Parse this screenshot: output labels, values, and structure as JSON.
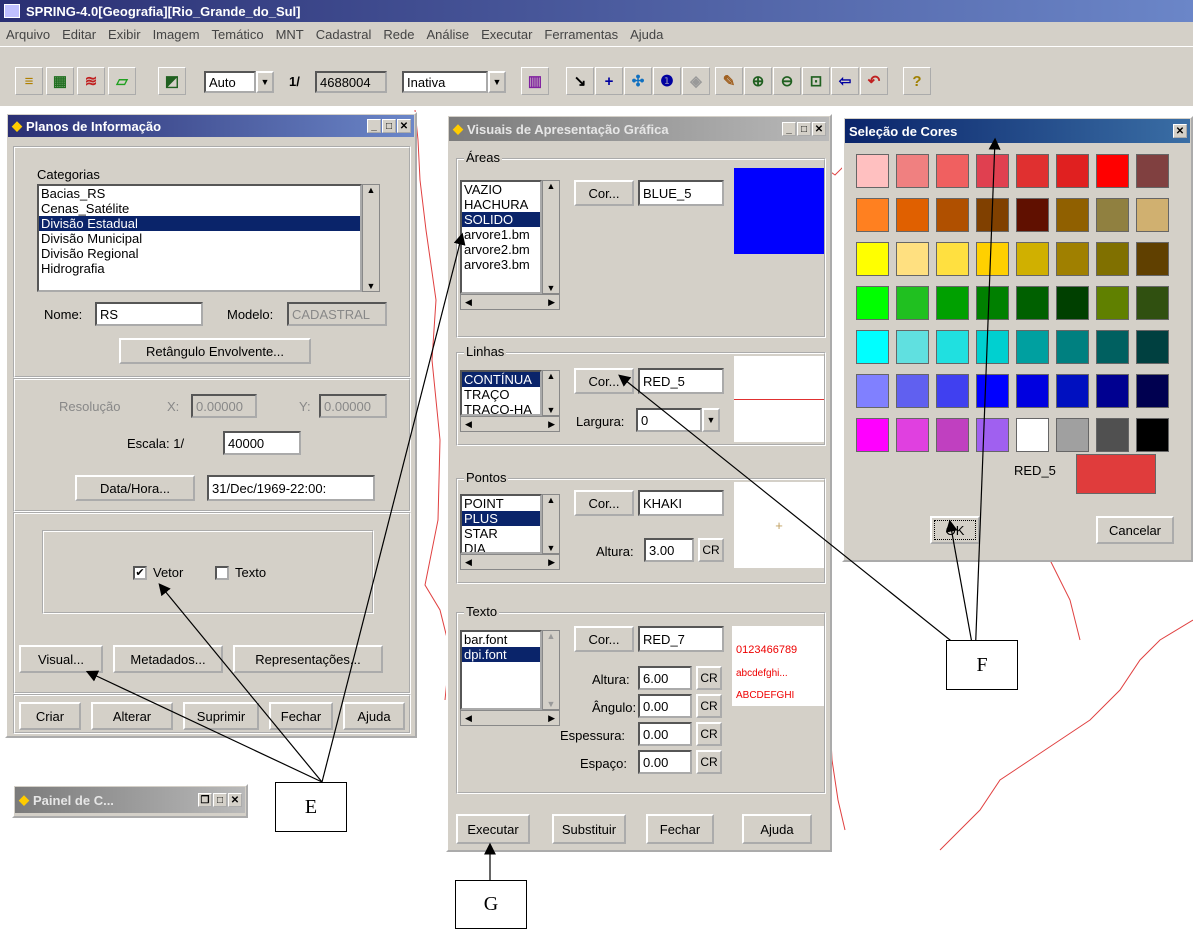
{
  "app": {
    "title": "SPRING-4.0[Geografia][Rio_Grande_do_Sul]"
  },
  "menu": [
    "Arquivo",
    "Editar",
    "Exibir",
    "Imagem",
    "Temático",
    "MNT",
    "Cadastral",
    "Rede",
    "Análise",
    "Executar",
    "Ferramentas",
    "Ajuda"
  ],
  "toolbar": {
    "mode_value": "Auto",
    "scale_prefix": "1/",
    "scale_value": "4688004",
    "state_value": "Inativa"
  },
  "planos": {
    "title": "Planos de Informação",
    "categories_label": "Categorias",
    "categories": [
      "Bacias_RS",
      "Cenas_Satélite",
      "Divisão Estadual",
      "Divisão Municipal",
      "Divisão Regional",
      "Hidrografia"
    ],
    "selected_category": "Divisão Estadual",
    "nome_label": "Nome:",
    "nome_value": "RS",
    "modelo_label": "Modelo:",
    "modelo_value": "CADASTRAL",
    "retangulo": "Retângulo Envolvente...",
    "resolucao": "Resolução",
    "x_label": "X:",
    "x_value": "0.00000",
    "y_label": "Y:",
    "y_value": "0.00000",
    "escala_label": "Escala: 1/",
    "escala_value": "40000",
    "datahora_btn": "Data/Hora...",
    "datahora_value": "31/Dec/1969-22:00:",
    "vetor": "Vetor",
    "texto": "Texto",
    "vetor_checked": "✔",
    "visual": "Visual...",
    "metadados": "Metadados...",
    "representacoes": "Representações...",
    "criar": "Criar",
    "alterar": "Alterar",
    "suprimir": "Suprimir",
    "fechar": "Fechar",
    "ajuda": "Ajuda"
  },
  "painel": {
    "title": "Painel de C..."
  },
  "visuais": {
    "title": "Visuais de Apresentação Gráfica",
    "areas": {
      "label": "Áreas",
      "items": [
        "VAZIO",
        "HACHURA",
        "SOLIDO",
        "arvore1.bm",
        "arvore2.bm",
        "arvore3.bm"
      ],
      "selected": "SOLIDO",
      "cor_btn": "Cor...",
      "cor_value": "BLUE_5",
      "color": "#0000ff"
    },
    "linhas": {
      "label": "Linhas",
      "items": [
        "CONTÍNUA",
        "TRAÇO",
        "TRAÇO-HA"
      ],
      "selected": "CONTÍNUA",
      "cor_btn": "Cor...",
      "cor_value": "RED_5",
      "largura_label": "Largura:",
      "largura_value": "0",
      "color": "#e03030"
    },
    "pontos": {
      "label": "Pontos",
      "items": [
        "POINT",
        "PLUS",
        "STAR",
        "DIA"
      ],
      "selected": "PLUS",
      "cor_btn": "Cor...",
      "cor_value": "KHAKI",
      "altura_label": "Altura:",
      "altura_value": "3.00",
      "cr": "CR",
      "symbol": "+"
    },
    "texto": {
      "label": "Texto",
      "items": [
        "bar.font",
        "dpi.font"
      ],
      "selected": "dpi.font",
      "cor_btn": "Cor...",
      "cor_value": "RED_7",
      "altura_label": "Altura:",
      "altura_value": "6.00",
      "angulo_label": "Ângulo:",
      "angulo_value": "0.00",
      "espessura_label": "Espessura:",
      "espessura_value": "0.00",
      "espaco_label": "Espaço:",
      "espaco_value": "0.00",
      "cr": "CR",
      "preview1": "0123466789",
      "preview2": "abcdefghi...",
      "preview3": "ABCDEFGHI"
    },
    "executar": "Executar",
    "substituir": "Substituir",
    "fechar": "Fechar",
    "ajuda": "Ajuda"
  },
  "cores": {
    "title": "Seleção de Cores",
    "selected_name": "RED_5",
    "selected_color": "#e03c3c",
    "ok": "OK",
    "cancelar": "Cancelar",
    "palette": [
      "#ffc0c0",
      "#f08080",
      "#f06060",
      "#e04050",
      "#e03030",
      "#e02020",
      "#ff0000",
      "#804040",
      "#ff8020",
      "#e06000",
      "#b05000",
      "#804000",
      "#601000",
      "#906000",
      "#908040",
      "#d0b070",
      "#ffff00",
      "#ffe080",
      "#ffe040",
      "#ffd000",
      "#d0b000",
      "#a08000",
      "#807000",
      "#604000",
      "#00ff00",
      "#20c020",
      "#00a000",
      "#008000",
      "#006000",
      "#004000",
      "#608000",
      "#305010",
      "#00ffff",
      "#60e0e0",
      "#20e0e0",
      "#00d0d0",
      "#00a0a0",
      "#008080",
      "#006060",
      "#004040",
      "#8080ff",
      "#6060f0",
      "#4040f0",
      "#0000ff",
      "#0000e0",
      "#0010c0",
      "#000090",
      "#000050",
      "#ff00ff",
      "#e040e0",
      "#c040c0",
      "#a060f0",
      "#ffffff",
      "#a0a0a0",
      "#505050",
      "#000000"
    ]
  },
  "annotations": {
    "e": "E",
    "f": "F",
    "g": "G"
  }
}
